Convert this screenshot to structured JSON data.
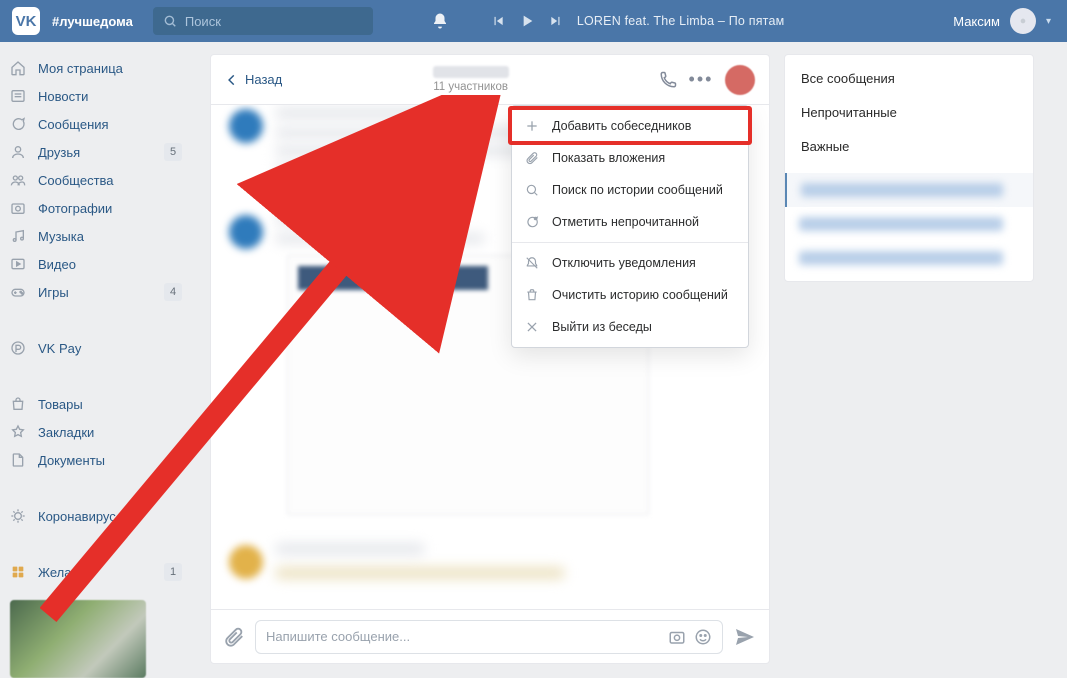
{
  "header": {
    "tagline": "#лучшедома",
    "search_placeholder": "Поиск",
    "now_playing": "LOREN feat. The Limba – По пятам",
    "user_name": "Максим"
  },
  "nav": {
    "items": [
      {
        "label": "Моя страница",
        "icon": "home"
      },
      {
        "label": "Новости",
        "icon": "feed"
      },
      {
        "label": "Сообщения",
        "icon": "messages"
      },
      {
        "label": "Друзья",
        "icon": "friends",
        "badge": "5"
      },
      {
        "label": "Сообщества",
        "icon": "groups"
      },
      {
        "label": "Фотографии",
        "icon": "photos"
      },
      {
        "label": "Музыка",
        "icon": "music"
      },
      {
        "label": "Видео",
        "icon": "video"
      },
      {
        "label": "Игры",
        "icon": "games",
        "badge": "4"
      }
    ],
    "items2": [
      {
        "label": "VK Pay",
        "icon": "pay"
      }
    ],
    "items3": [
      {
        "label": "Товары",
        "icon": "market"
      },
      {
        "label": "Закладки",
        "icon": "bookmarks"
      },
      {
        "label": "Документы",
        "icon": "docs"
      }
    ],
    "items4": [
      {
        "label": "Коронавирус",
        "icon": "virus"
      }
    ],
    "items5": [
      {
        "label": "Желания",
        "icon": "wish",
        "badge": "1"
      }
    ]
  },
  "chat": {
    "back_label": "Назад",
    "participants": "11 участников",
    "message_placeholder": "Напишите сообщение..."
  },
  "dropdown": {
    "items": [
      "Добавить собеседников",
      "Показать вложения",
      "Поиск по истории сообщений",
      "Отметить непрочитанной",
      "Отключить уведомления",
      "Очистить историю сообщений",
      "Выйти из беседы"
    ]
  },
  "filters": {
    "items": [
      "Все сообщения",
      "Непрочитанные",
      "Важные"
    ]
  }
}
